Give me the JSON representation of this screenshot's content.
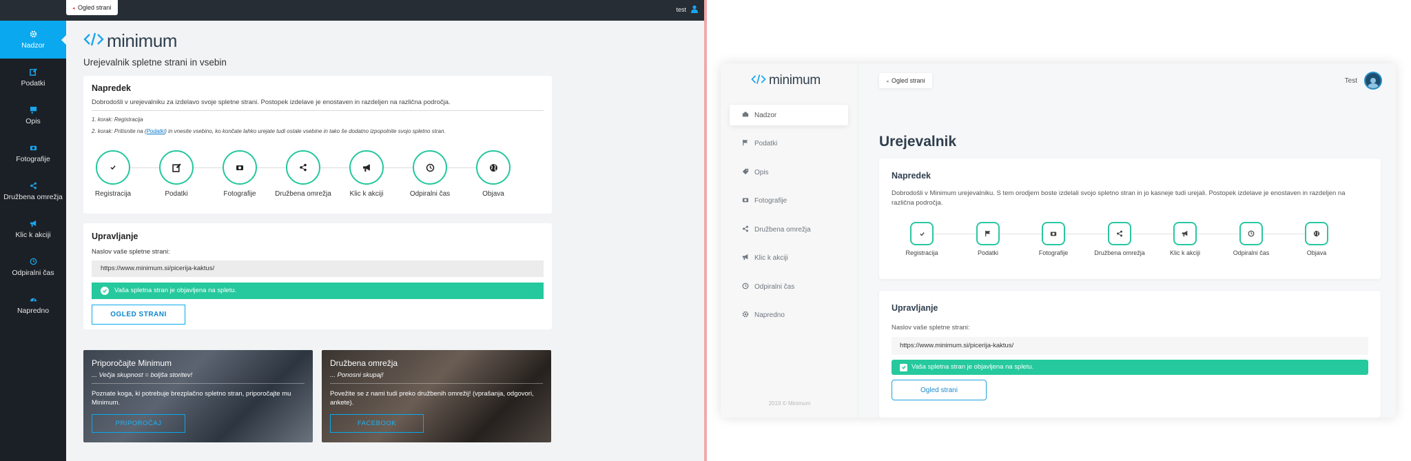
{
  "left": {
    "topbar": {
      "view_page_label": "Ogled strani",
      "user_name": "test"
    },
    "sidebar": {
      "items": [
        {
          "label": "Nadzor",
          "icon": "gear-icon",
          "active": true
        },
        {
          "label": "Podatki",
          "icon": "edit-icon"
        },
        {
          "label": "Opis",
          "icon": "card-icon"
        },
        {
          "label": "Fotografije",
          "icon": "camera-icon"
        },
        {
          "label": "Družbena omrežja",
          "icon": "share-icon"
        },
        {
          "label": "Klic k akciji",
          "icon": "megaphone-icon"
        },
        {
          "label": "Odpiralni čas",
          "icon": "clock-icon"
        },
        {
          "label": "Napredno",
          "icon": "dashboard-icon"
        }
      ]
    },
    "logo": "minimum",
    "subtitle": "Urejevalnik spletne strani in vsebin",
    "progress": {
      "title": "Napredek",
      "intro": "Dobrodošli v urejevalniku za izdelavo svoje spletne strani. Postopek izdelave je enostaven in razdeljen na različna področja.",
      "step1_note": "1. korak: Registracija",
      "step2_note_pre": "2. korak: Pritisnite na (",
      "step2_note_link": "Podatki",
      "step2_note_post": ") in vnesite vsebino, ko končate lahko urejate tudi ostale vsebine in tako še dodatno izpopolnite svojo spletno stran.",
      "steps": [
        {
          "label": "Registracija",
          "icon": "check-icon"
        },
        {
          "label": "Podatki",
          "icon": "edit-icon"
        },
        {
          "label": "Fotografije",
          "icon": "camera-icon"
        },
        {
          "label": "Družbena omrežja",
          "icon": "share-icon"
        },
        {
          "label": "Klic k akciji",
          "icon": "megaphone-icon"
        },
        {
          "label": "Odpiralni čas",
          "icon": "clock-icon"
        },
        {
          "label": "Objava",
          "icon": "globe-icon"
        }
      ]
    },
    "manage": {
      "title": "Upravljanje",
      "field_label": "Naslov vaše spletne strani:",
      "url": "https://www.minimum.si/picerija-kaktus/",
      "success": "Vaša spletna stran je objavljena na spletu.",
      "view_button": "OGLED STRANI"
    },
    "promos": [
      {
        "title": "Priporočajte Minimum",
        "subtitle": "... Večja skupnost = boljša storitev!",
        "text": "Poznate koga, ki potrebuje brezplačno spletno stran, priporočajte mu Minimum.",
        "button": "PRIPOROČAJ"
      },
      {
        "title": "Družbena omrežja",
        "subtitle": "... Ponosni skupaj!",
        "text": "Povežite se z nami tudi preko družbenih omrežij! (vprašanja, odgovori, ankete).",
        "button": "FACEBOOK"
      }
    ]
  },
  "right": {
    "logo": "minimum",
    "nav": [
      {
        "label": "Nadzor",
        "icon": "dashboard-icon",
        "active": true
      },
      {
        "label": "Podatki",
        "icon": "flag-icon"
      },
      {
        "label": "Opis",
        "icon": "tag-icon"
      },
      {
        "label": "Fotografije",
        "icon": "camera-icon"
      },
      {
        "label": "Družbena omrežja",
        "icon": "share-icon"
      },
      {
        "label": "Klic k akciji",
        "icon": "megaphone-icon"
      },
      {
        "label": "Odpiralni čas",
        "icon": "clock-icon"
      },
      {
        "label": "Napredno",
        "icon": "gear-icon"
      }
    ],
    "footer": "2019 © Minimum",
    "view_page_label": "Ogled strani",
    "user_name": "Test",
    "page_title": "Urejevalnik",
    "progress": {
      "title": "Napredek",
      "intro": "Dobrodošli v Minimum urejevalniku. S tem orodjem boste izdelali svojo spletno stran in jo kasneje tudi urejali. Postopek izdelave je enostaven in razdeljen na različna področja.",
      "steps": [
        {
          "label": "Registracija",
          "icon": "check-icon"
        },
        {
          "label": "Podatki",
          "icon": "flag-icon"
        },
        {
          "label": "Fotografije",
          "icon": "camera-icon"
        },
        {
          "label": "Družbena omrežja",
          "icon": "share-icon"
        },
        {
          "label": "Klic k akciji",
          "icon": "megaphone-icon"
        },
        {
          "label": "Odpiralni čas",
          "icon": "clock-icon"
        },
        {
          "label": "Objava",
          "icon": "globe-icon"
        }
      ]
    },
    "manage": {
      "title": "Upravljanje",
      "field_label": "Naslov vaše spletne strani:",
      "url": "https://www.minimum.si/picerija-kaktus/",
      "success": "Vaša spletna stran je objavljena na spletu.",
      "view_button": "Ogled strani"
    }
  },
  "colors": {
    "accent_blue": "#0aa8ee",
    "success_green": "#25c99d",
    "dark_sidebar": "#1b2026"
  }
}
